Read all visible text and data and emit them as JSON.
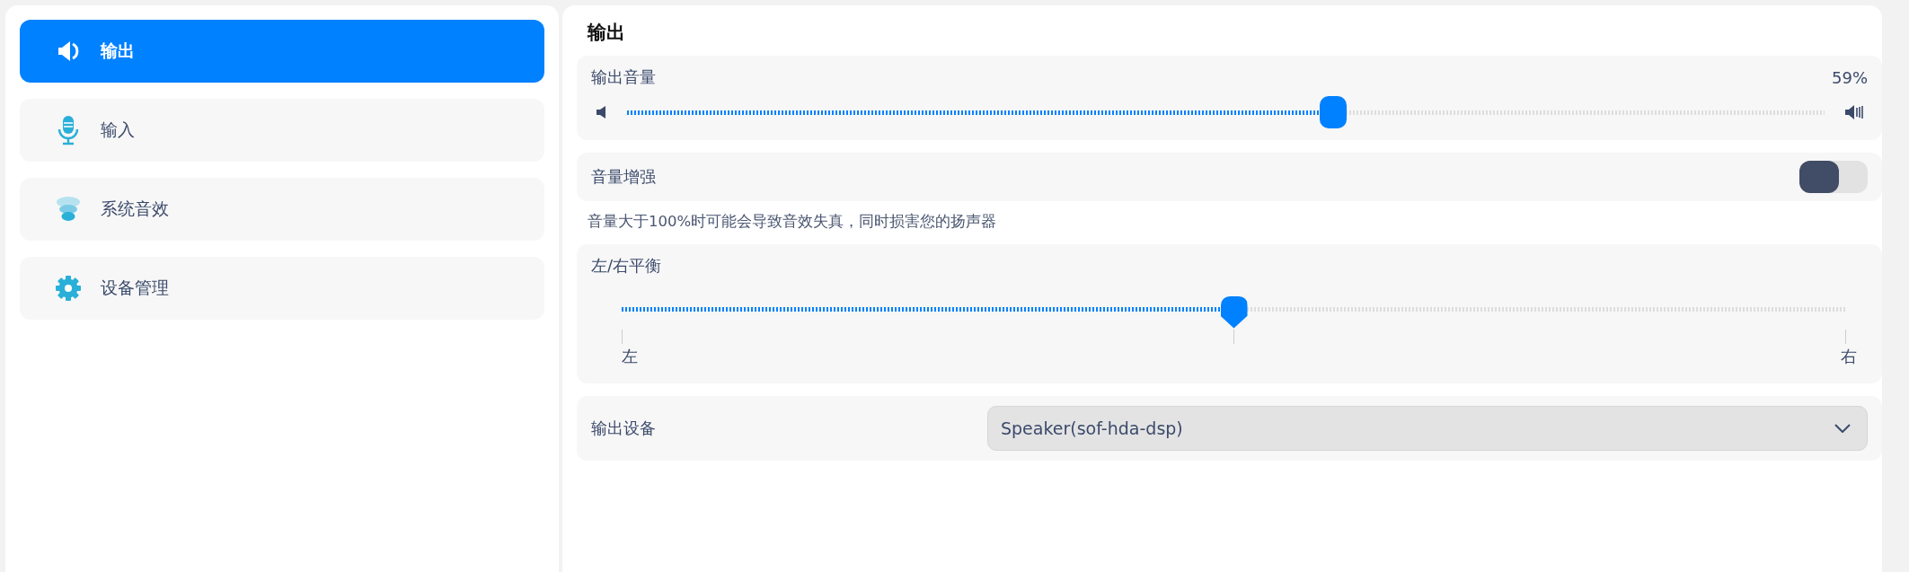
{
  "sidebar": {
    "items": [
      {
        "label": "输出",
        "kind": "speaker",
        "selected": true
      },
      {
        "label": "输入",
        "kind": "mic",
        "selected": false
      },
      {
        "label": "系统音效",
        "kind": "effects",
        "selected": false
      },
      {
        "label": "设备管理",
        "kind": "gear",
        "selected": false
      }
    ]
  },
  "page": {
    "title": "输出",
    "volume": {
      "label": "输出音量",
      "reading": "59%",
      "level": 0.59
    },
    "boost": {
      "label": "音量增强",
      "on": false,
      "hint": "音量大于100%时可能会导致音效失真，同时损害您的扬声器"
    },
    "balance": {
      "label": "左/右平衡",
      "level": 0.5,
      "left": "左",
      "right": "右"
    },
    "device": {
      "label": "输出设备",
      "value": "Speaker(sof-hda-dsp)"
    }
  }
}
